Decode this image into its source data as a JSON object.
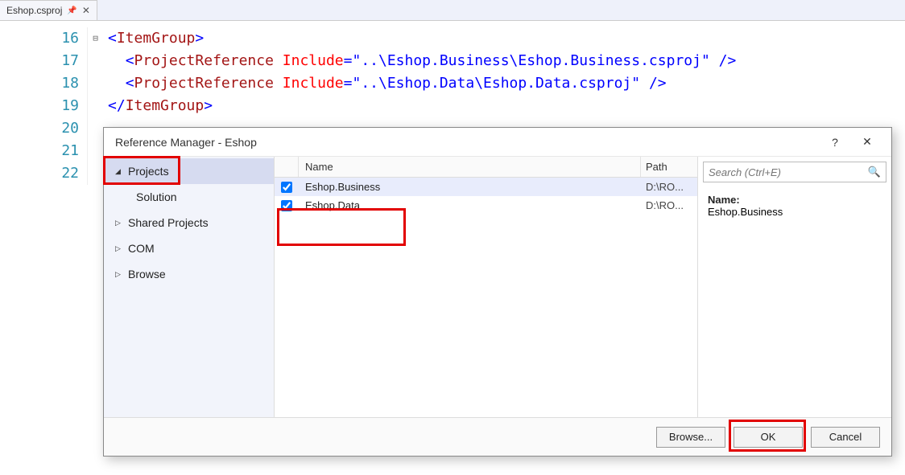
{
  "tab": {
    "label": "Eshop.csproj"
  },
  "code": {
    "lines": [
      16,
      17,
      18,
      19,
      20,
      21,
      22
    ],
    "l16": {
      "open": "<",
      "tag": "ItemGroup",
      "close": ">"
    },
    "l17": {
      "open": "<",
      "tag": "ProjectReference",
      "sp": " ",
      "attr": "Include",
      "eq": "=",
      "q1": "\"",
      "val": "..\\Eshop.Business\\Eshop.Business.csproj",
      "q2": "\" />"
    },
    "l18": {
      "open": "<",
      "tag": "ProjectReference",
      "sp": " ",
      "attr": "Include",
      "eq": "=",
      "q1": "\"",
      "val": "..\\Eshop.Data\\Eshop.Data.csproj",
      "q2": "\" />"
    },
    "l19": {
      "open": "</",
      "tag": "ItemGroup",
      "close": ">"
    }
  },
  "dialog": {
    "title": "Reference Manager - Eshop",
    "sidebar": {
      "items": [
        {
          "label": "Projects",
          "expanded": true,
          "selected": true
        },
        {
          "label": "Solution",
          "sub": true
        },
        {
          "label": "Shared Projects",
          "expanded": false
        },
        {
          "label": "COM",
          "expanded": false
        },
        {
          "label": "Browse",
          "expanded": false
        }
      ]
    },
    "columns": {
      "name": "Name",
      "path": "Path"
    },
    "rows": [
      {
        "checked": true,
        "name": "Eshop.Business",
        "path": "D:\\RO...",
        "selected": true
      },
      {
        "checked": true,
        "name": "Eshop.Data",
        "path": "D:\\RO...",
        "selected": false
      }
    ],
    "details": {
      "label": "Name:",
      "value": "Eshop.Business"
    },
    "search_placeholder": "Search (Ctrl+E)",
    "buttons": {
      "browse": "Browse...",
      "ok": "OK",
      "cancel": "Cancel"
    }
  }
}
